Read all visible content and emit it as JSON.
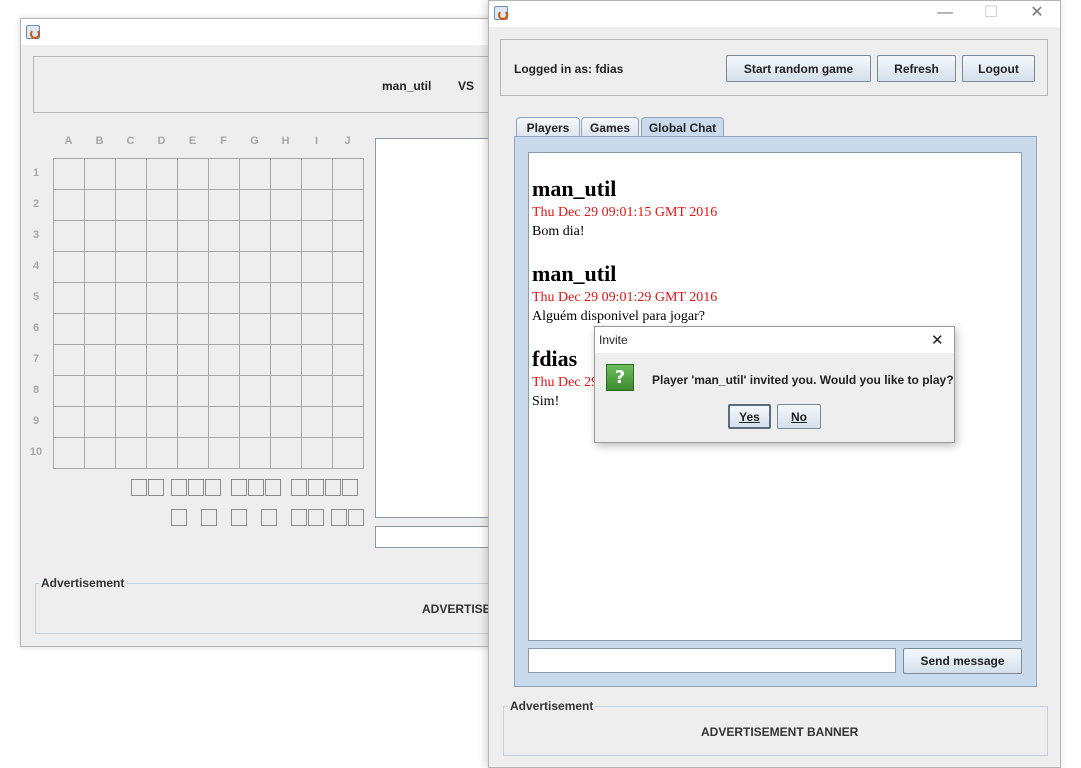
{
  "game_window": {
    "player_left": "man_util",
    "vs_label": "VS",
    "columns": [
      "A",
      "B",
      "C",
      "D",
      "E",
      "F",
      "G",
      "H",
      "I",
      "J"
    ],
    "rows": [
      "1",
      "2",
      "3",
      "4",
      "5",
      "6",
      "7",
      "8",
      "9",
      "10"
    ],
    "ad_title": "Advertisement",
    "ad_banner": "ADVERTISEM"
  },
  "lobby_window": {
    "logged_in_label": "Logged in as: fdias",
    "buttons": {
      "start_random": "Start random game",
      "refresh": "Refresh",
      "logout": "Logout"
    },
    "tabs": [
      "Players",
      "Games",
      "Global Chat"
    ],
    "active_tab": "Global Chat",
    "messages": [
      {
        "author": "man_util",
        "date": "Thu Dec 29 09:01:15 GMT 2016",
        "text": "Bom dia!"
      },
      {
        "author": "man_util",
        "date": "Thu Dec 29 09:01:29 GMT 2016",
        "text": "Alguém disponivel para jogar?"
      },
      {
        "author": "fdias",
        "date": "Thu Dec 29",
        "text": "Sim!"
      }
    ],
    "message_input_value": "",
    "send_button": "Send message",
    "ad_title": "Advertisement",
    "ad_banner": "ADVERTISEMENT BANNER"
  },
  "invite_dialog": {
    "title": "Invite",
    "message": "Player 'man_util' invited you. Would you like to play?",
    "icon": "question-icon",
    "yes_label": "Yes",
    "no_label": "No"
  },
  "colors": {
    "chat_date": "#e01515",
    "tab_panel": "#c9daec",
    "question_icon_bg": "#4a9a3a"
  }
}
